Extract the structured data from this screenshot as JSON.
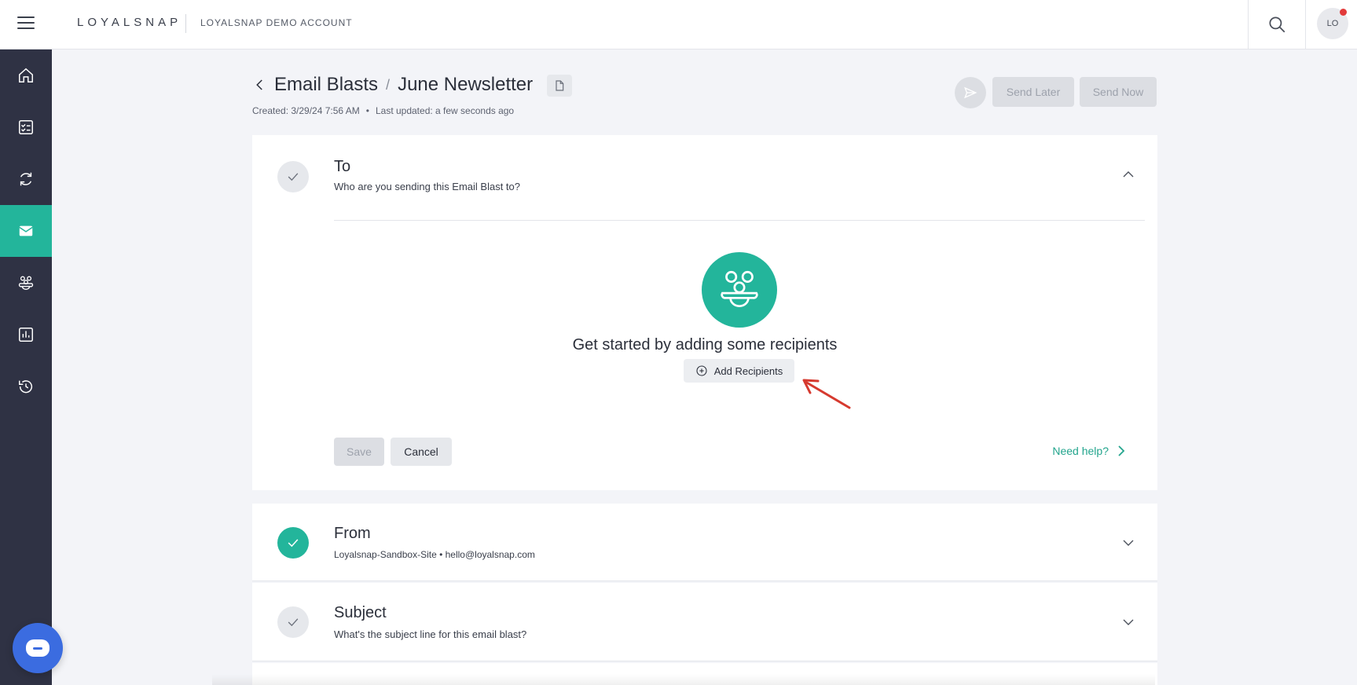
{
  "topbar": {
    "logo": "LOYALSNAP",
    "account_name": "LOYALSNAP DEMO ACCOUNT",
    "avatar_initials": "LO"
  },
  "sidebar": {
    "items": [
      {
        "name": "home-icon",
        "active": false
      },
      {
        "name": "checklist-icon",
        "active": false
      },
      {
        "name": "refresh-icon",
        "active": false
      },
      {
        "name": "mail-icon",
        "active": true
      },
      {
        "name": "people-icon",
        "active": false
      },
      {
        "name": "chart-icon",
        "active": false
      },
      {
        "name": "history-icon",
        "active": false
      }
    ]
  },
  "header": {
    "breadcrumb_parent": "Email Blasts",
    "breadcrumb_sep": "/",
    "breadcrumb_current": "June Newsletter",
    "created": "Created: 3/29/24 7:56 AM",
    "meta_dot": "•",
    "updated": "Last updated: a few seconds ago",
    "send_later": "Send Later",
    "send_now": "Send Now"
  },
  "to_section": {
    "title": "To",
    "subtitle": "Who are you sending this Email Blast to?",
    "empty_title": "Get started by adding some recipients",
    "add_button": "Add Recipients",
    "save": "Save",
    "cancel": "Cancel",
    "help": "Need help?"
  },
  "from_section": {
    "title": "From",
    "subtitle": "Loyalsnap-Sandbox-Site • hello@loyalsnap.com"
  },
  "subject_section": {
    "title": "Subject",
    "subtitle": "What's the subject line for this email blast?"
  },
  "colors": {
    "accent": "#23b59b",
    "sidebar": "#2f3244",
    "chat": "#3b6ce0",
    "annotation_arrow": "#d63a2f"
  }
}
